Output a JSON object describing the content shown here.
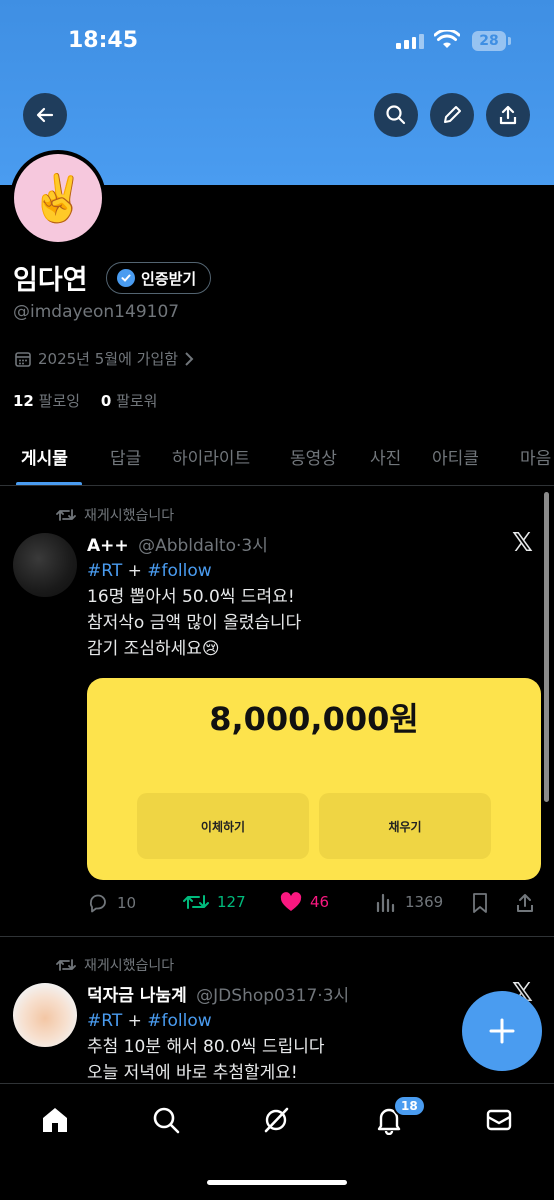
{
  "status_bar": {
    "time": "18:45",
    "battery": "28"
  },
  "header": {
    "back_icon": "arrow-left-icon",
    "search_icon": "search-icon",
    "edit_icon": "pencil-icon",
    "share_icon": "share-icon",
    "banner_color": "#4a9cf0"
  },
  "profile": {
    "avatar_emoji": "✌️",
    "name": "임다연",
    "verify_label": "인증받기",
    "handle": "@imdayeon149107",
    "joined": "2025년 5월에 가입함",
    "following_count": "12",
    "following_label": "팔로잉",
    "followers_count": "0",
    "followers_label": "팔로워"
  },
  "tabs": [
    "게시물",
    "답글",
    "하이라이트",
    "동영상",
    "사진",
    "아티클",
    "마음"
  ],
  "posts": [
    {
      "repost_label": "재게시했습니다",
      "name": "A++",
      "handle": "@Abbldalto",
      "time": "·3시",
      "tag1": "#RT",
      "plus": " + ",
      "tag2": "#follow",
      "line1": "16명 뽑아서 50.0씩 드려요!",
      "line2": "참저삭o 금액 많이 올렸습니다",
      "line3": "감기 조심하세요😢",
      "card": {
        "amount": "8,000,000원",
        "button1": "이체하기",
        "button2": "채우기"
      },
      "replies": "10",
      "reposts": "127",
      "likes": "46",
      "views": "1369"
    },
    {
      "repost_label": "재게시했습니다",
      "name": "덕자금 나눔계",
      "handle": "@JDShop0317",
      "time": "·3시",
      "tag1": "#RT",
      "plus": " + ",
      "tag2": "#follow",
      "line1": "추첨 10분 해서 80.0씩 드립니다",
      "line2": "오늘 저녁에 바로 추첨할게요!"
    }
  ],
  "bottom_nav": {
    "notification_count": "18"
  },
  "colors": {
    "accent": "#4a9cf0",
    "repost_green": "#00ba7c",
    "like_pink": "#f91880",
    "card_yellow": "#fde34c"
  }
}
